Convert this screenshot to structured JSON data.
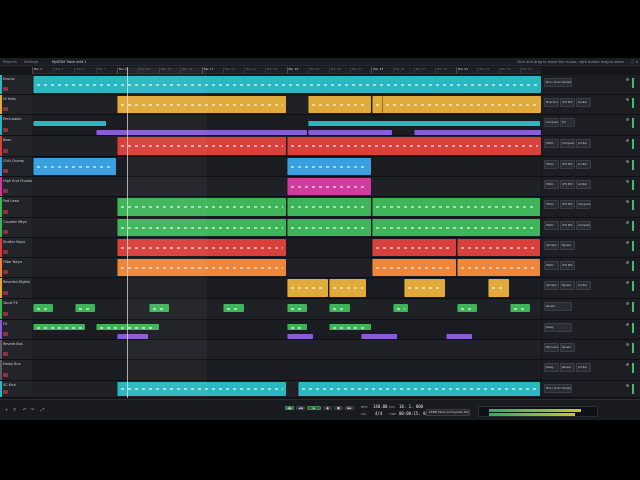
{
  "topbar": {
    "tabs": [
      {
        "label": "Projects"
      },
      {
        "label": "Settings"
      },
      {
        "label": "MyEDM Track edit 1",
        "active": true
      }
    ],
    "hint": "Click and drag to move the cursor, right button drag to zoom",
    "win": {
      "min": "–",
      "max": "□",
      "close": "×"
    }
  },
  "ruler": {
    "bars": [
      {
        "label": "Bar 1",
        "major": true
      },
      {
        "label": "Bar 3"
      },
      {
        "label": "Bar 5"
      },
      {
        "label": "Bar 7"
      },
      {
        "label": "Bar 9",
        "major": true
      },
      {
        "label": "Bar 11"
      },
      {
        "label": "Bar 13"
      },
      {
        "label": "Bar 15"
      },
      {
        "label": "Bar 17",
        "major": true
      },
      {
        "label": "Bar 19"
      },
      {
        "label": "Bar 21"
      },
      {
        "label": "Bar 23"
      },
      {
        "label": "Bar 25",
        "major": true
      },
      {
        "label": "Bar 27"
      },
      {
        "label": "Bar 29"
      },
      {
        "label": "Bar 31"
      },
      {
        "label": "Bar 33",
        "major": true
      },
      {
        "label": "Bar 35"
      },
      {
        "label": "Bar 37"
      },
      {
        "label": "Bar 39"
      },
      {
        "label": "Bar 41",
        "major": true
      },
      {
        "label": "Bar 43"
      },
      {
        "label": "Bar 45"
      },
      {
        "label": "Bar 47"
      }
    ]
  },
  "tracks": [
    {
      "name": "Drums",
      "color": "#2bb7c0"
    },
    {
      "name": "Hi Hats",
      "color": "#e0ab3a"
    },
    {
      "name": "Percussion",
      "color": "#2bb7c0"
    },
    {
      "name": "Bass",
      "color": "#d9403c"
    },
    {
      "name": "Chill Chords",
      "color": "#3aa0e0"
    },
    {
      "name": "High End Chords",
      "color": "#d23b9e"
    },
    {
      "name": "Pad Lead",
      "color": "#3fb55a"
    },
    {
      "name": "Counter Mtya",
      "color": "#3fb55a"
    },
    {
      "name": "Stutter Nayo",
      "color": "#d9403c"
    },
    {
      "name": "Filter Nayo",
      "color": "#f0863a"
    },
    {
      "name": "Reverbd Digital",
      "color": "#e0ab3a"
    },
    {
      "name": "Vocal FX",
      "color": "#3fb55a"
    },
    {
      "name": "FX",
      "color": "#8a5cd6"
    },
    {
      "name": "Reverb Bus",
      "color": "#5a5c66"
    },
    {
      "name": "Delay Bus",
      "color": "#5a5c66"
    },
    {
      "name": "SC Kick",
      "color": "#2bb7c0"
    }
  ],
  "devices": [
    {
      "chips": [
        "Micro Drum Sampler"
      ]
    },
    {
      "chips": [
        "Multi Drum Sampler",
        "LFO MIX",
        "Limiter"
      ]
    },
    {
      "chips": [
        "Compressor",
        "EQ"
      ]
    },
    {
      "chips": [
        "HSDC",
        "Compressor",
        "Limiter"
      ]
    },
    {
      "chips": [
        "HSDC",
        "LFO MIX",
        "Limiter"
      ]
    },
    {
      "chips": [
        "HSDC",
        "LFO MIX",
        "Limiter"
      ]
    },
    {
      "chips": [
        "HSDC",
        "LFO MIX",
        "Compressor"
      ]
    },
    {
      "chips": [
        "HSDC",
        "LFO MIX",
        "Compressor"
      ]
    },
    {
      "chips": [
        "Sampler",
        "Reverb"
      ]
    },
    {
      "chips": [
        "HSDC",
        "LFO MIX"
      ]
    },
    {
      "chips": [
        "Sampler",
        "Reverb",
        "Limiter"
      ]
    },
    {
      "chips": [
        "Reverb"
      ]
    },
    {
      "chips": [
        "Delay"
      ]
    },
    {
      "chips": [
        "Bitcrusher",
        "Reverb"
      ]
    },
    {
      "chips": [
        "Delay",
        "Reverb",
        "Limiter"
      ]
    },
    {
      "chips": [
        "Micro Drum Sampler"
      ]
    }
  ],
  "transport": {
    "tempo_label": "BPM",
    "tempo": "140.00",
    "sig_label": "SIG",
    "signature": "4/4",
    "pos_label": "POS",
    "position": "10. 1. 000",
    "time_label": "TIME",
    "time": "00:00:15. 857",
    "project_info": "EPNB Medical Playlists Notes",
    "buttons": {
      "loop": "◀▶",
      "rew": "◀◀",
      "play": "▶",
      "rec": "●",
      "stop": "■",
      "ff": "▶▶"
    }
  },
  "icons": {
    "add": "+",
    "delete": "✕",
    "undo": "↶",
    "redo": "↷",
    "link": "⤢"
  }
}
